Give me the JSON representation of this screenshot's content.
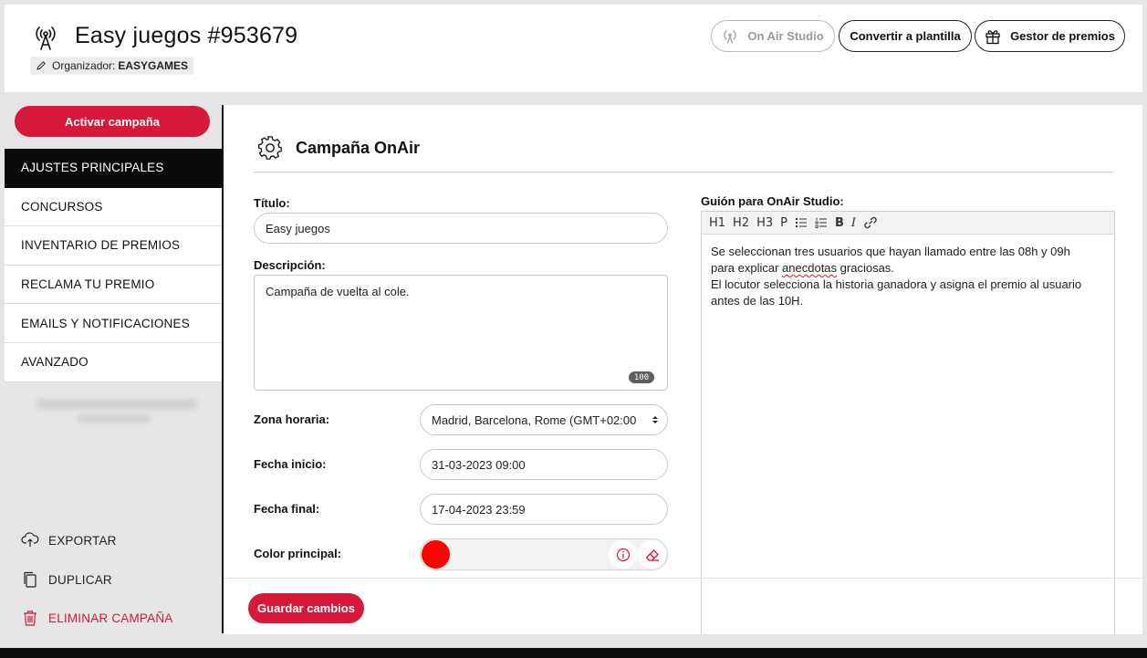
{
  "header": {
    "title": "Easy juegos #953679",
    "organizer_label": "Organizador:",
    "organizer_value": "EASYGAMES",
    "buttons": {
      "onair_studio": "On Air Studio",
      "convert_template": "Convertir a plantilla",
      "prize_manager": "Gestor de premios"
    }
  },
  "sidebar": {
    "activate_button": "Activar campaña",
    "items": [
      {
        "label": "AJUSTES PRINCIPALES",
        "active": true
      },
      {
        "label": "CONCURSOS",
        "active": false
      },
      {
        "label": "INVENTARIO DE PREMIOS",
        "active": false
      },
      {
        "label": "RECLAMA TU PREMIO",
        "active": false
      },
      {
        "label": "EMAILS Y NOTIFICACIONES",
        "active": false
      },
      {
        "label": "AVANZADO",
        "active": false
      }
    ],
    "actions": {
      "export": "EXPORTAR",
      "duplicate": "DUPLICAR",
      "delete": "ELIMINAR CAMPAÑA"
    }
  },
  "main": {
    "section_title": "Campaña OnAir",
    "fields": {
      "title_label": "Título:",
      "title_value": "Easy juegos",
      "description_label": "Descripción:",
      "description_value": "Campaña de vuelta al cole.",
      "description_counter": "100",
      "timezone_label": "Zona horaria:",
      "timezone_value": "Madrid, Barcelona, Rome (GMT+02:00",
      "start_label": "Fecha inicio:",
      "start_value": "31-03-2023 09:00",
      "end_label": "Fecha final:",
      "end_value": "17-04-2023 23:59",
      "color_label": "Color principal:",
      "color_value": "#ff0000"
    },
    "script": {
      "label": "Guión para OnAir Studio:",
      "toolbar": [
        "H1",
        "H2",
        "H3",
        "P",
        "bullet-list-icon",
        "numbered-list-icon",
        "B",
        "I",
        "link-icon"
      ],
      "line1_a": "Se seleccionan tres usuarios que hayan llamado entre las 08h y 09h",
      "line2_a": "para explicar ",
      "line2_b": "anecdotas",
      "line2_c": " graciosas.",
      "line3": "El locutor selecciona la historia ganadora y asigna el premio al usuario",
      "line4": "antes de las 10H."
    },
    "save_button": "Guardar cambios"
  },
  "colors": {
    "accent": "#d6193a",
    "active_menu": "#0a0a0a",
    "sidebar_bg": "#e6e6e8"
  }
}
